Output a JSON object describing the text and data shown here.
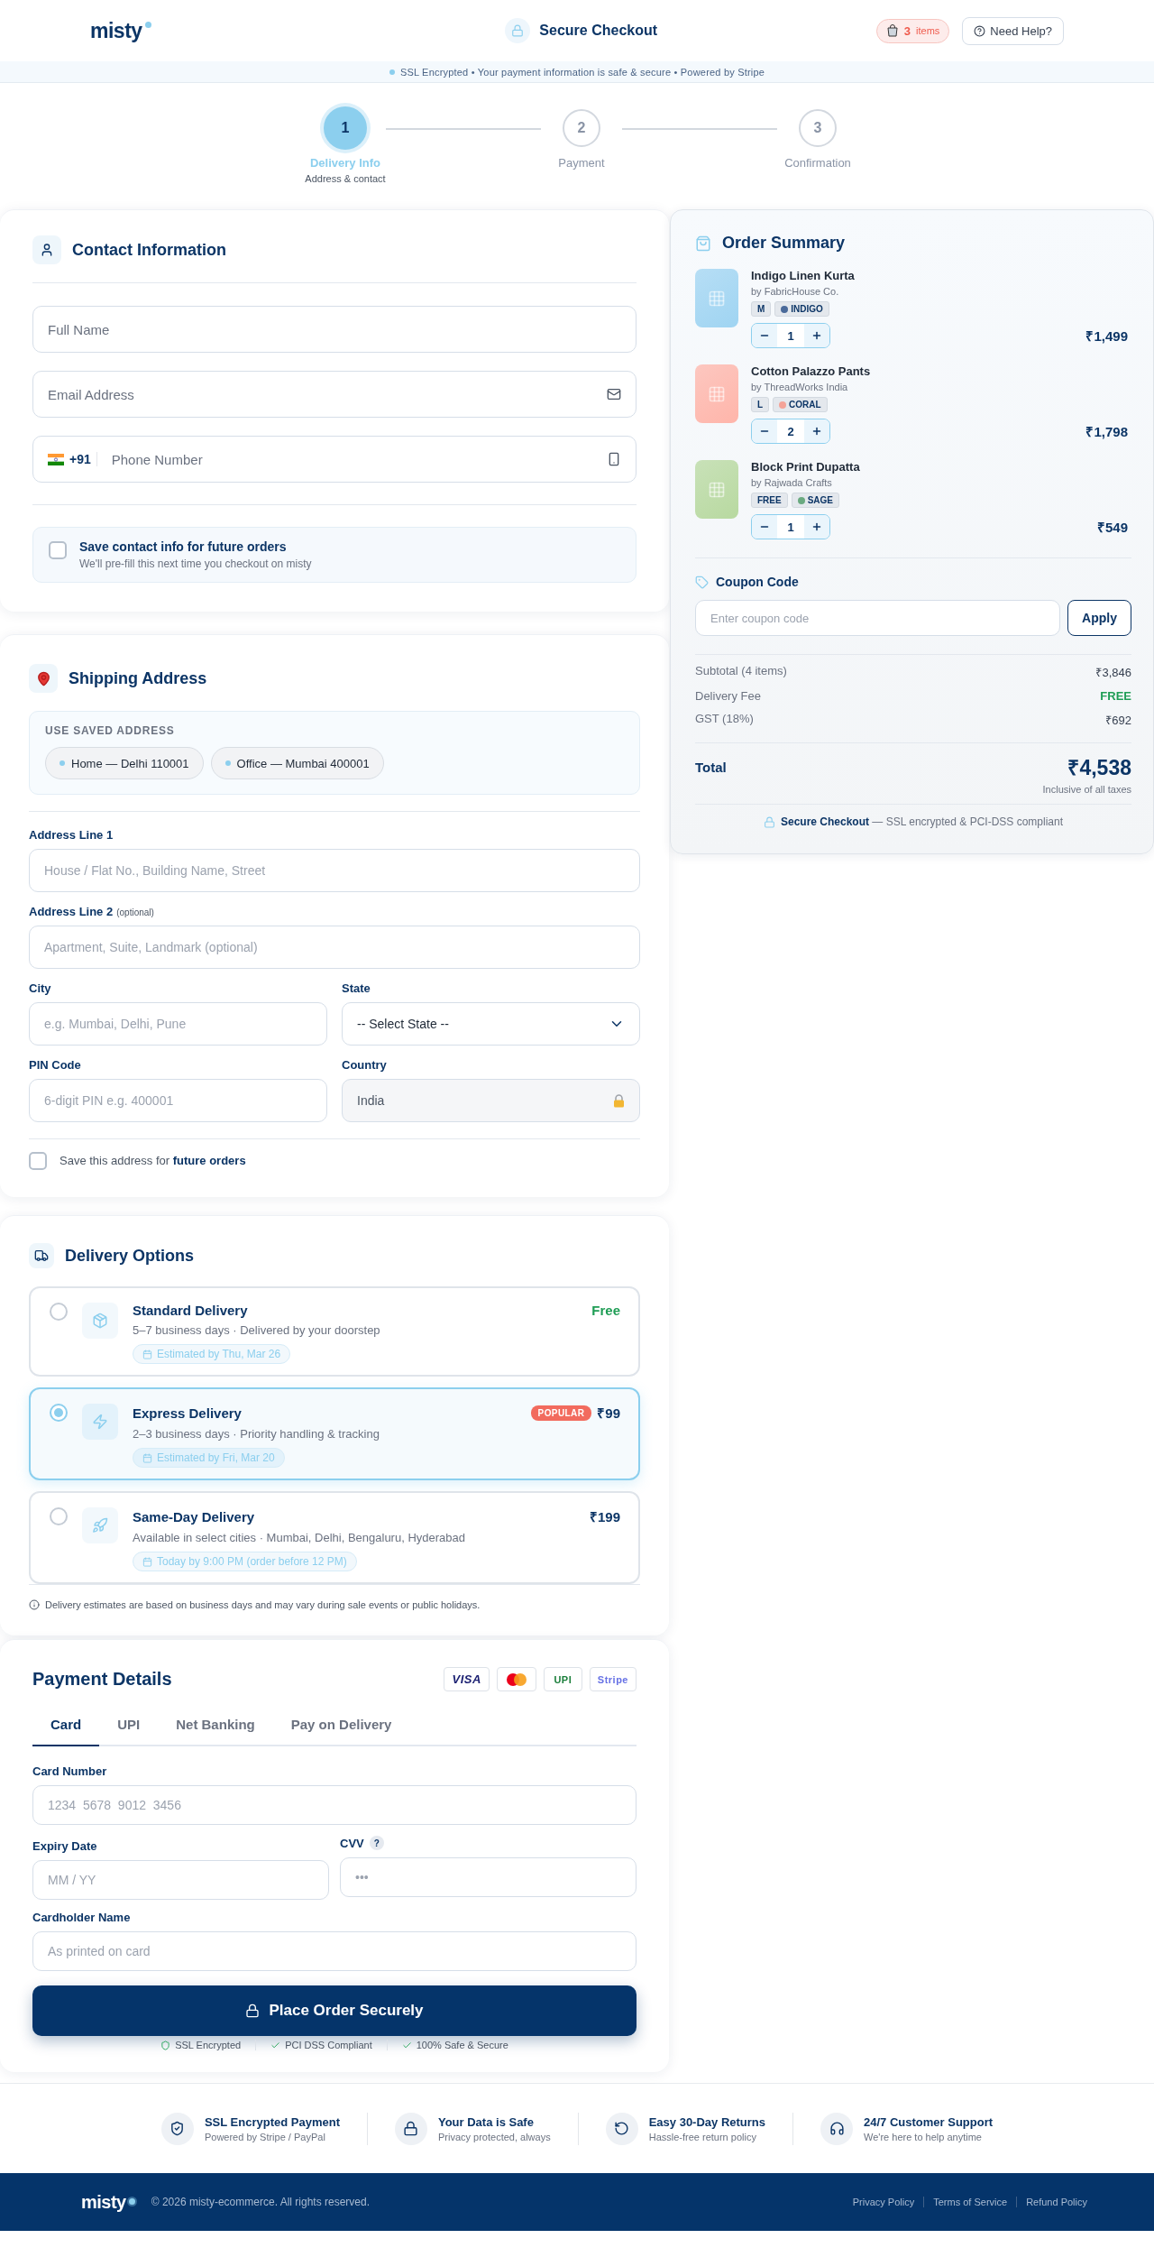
{
  "header": {
    "logo": "misty",
    "title": "Secure Checkout",
    "cart": {
      "count": "3",
      "label": "items"
    },
    "help": "Need Help?"
  },
  "banner": "SSL Encrypted • Your payment information is safe & secure • Powered by Stripe",
  "steps": [
    {
      "number": "1",
      "label": "Delivery Info",
      "sublabel": "Address & contact",
      "selected": true
    },
    {
      "number": "2",
      "label": "Payment",
      "selected": false
    },
    {
      "number": "3",
      "label": "Confirmation",
      "selected": false
    }
  ],
  "contact": {
    "title": "Contact Information",
    "fields": [
      {
        "kind": "text",
        "placeholder": "Full Name"
      },
      {
        "kind": "email",
        "placeholder": "Email Address"
      },
      {
        "kind": "phone",
        "prefix": "+91",
        "placeholder": "Phone Number"
      }
    ],
    "save": {
      "title": "Save contact info for future orders",
      "note": "We'll pre-fill this next time you checkout on misty",
      "checked": false
    }
  },
  "shipping": {
    "title": "Shipping Address",
    "saved": {
      "label": "USE SAVED ADDRESS",
      "chips": [
        {
          "text": "Home — Delhi 110001",
          "selected": false
        },
        {
          "text": "Office — Mumbai 400001",
          "selected": false
        }
      ]
    },
    "fields": [
      {
        "kind": "text",
        "label": "Address Line 1",
        "placeholder": "House / Flat No., Building Name, Street"
      },
      {
        "kind": "text",
        "label": "Address Line 2",
        "note": "(optional)",
        "placeholder": "Apartment, Suite, Landmark (optional)"
      },
      {
        "kind": "text",
        "label": "City",
        "placeholder": "e.g. Mumbai, Delhi, Pune"
      },
      {
        "kind": "select",
        "label": "State",
        "value": "-- Select State --"
      },
      {
        "kind": "text",
        "label": "PIN Code",
        "placeholder": "6-digit PIN e.g. 400001"
      },
      {
        "kind": "locked",
        "label": "Country",
        "value": "India"
      }
    ],
    "save": {
      "text": "Save this address for **future orders**",
      "checked": false
    }
  },
  "delivery": {
    "title": "Delivery Options",
    "options": [
      {
        "kind": "box",
        "title": "Standard Delivery",
        "description": "5–7 business days · Delivered by your doorstep",
        "estimate": "Estimated by Thu, Mar 26",
        "price": "Free",
        "free": true,
        "selected": false
      },
      {
        "kind": "bolt",
        "title": "Express Delivery",
        "description": "2–3 business days · Priority handling & tracking",
        "estimate": "Estimated by Fri, Mar 20",
        "badge": "POPULAR",
        "price": "₹99",
        "free": false,
        "selected": true
      },
      {
        "kind": "rocket",
        "title": "Same-Day Delivery",
        "description": "Available in select cities · Mumbai, Delhi, Bengaluru, Hyderabad",
        "estimate": "Today by 9:00 PM (order before 12 PM)",
        "price": "₹199",
        "free": false,
        "selected": false
      }
    ],
    "note": "Delivery estimates are based on business days and may vary during sale events or public holidays."
  },
  "payment": {
    "title": "Payment Details",
    "brands": [
      {
        "kind": "visa",
        "text": "VISA"
      },
      {
        "kind": "mastercard"
      },
      {
        "kind": "upi",
        "text": "UPI"
      },
      {
        "kind": "stripe",
        "text": "Stripe"
      }
    ],
    "tabs": [
      {
        "label": "Card",
        "selected": true
      },
      {
        "label": "UPI",
        "selected": false
      },
      {
        "label": "Net Banking",
        "selected": false
      },
      {
        "label": "Pay on Delivery",
        "selected": false
      }
    ],
    "card_number": {
      "label": "Card Number",
      "placeholder": "1234  5678  9012  3456"
    },
    "expiry": {
      "label": "Expiry Date",
      "placeholder": "MM / YY"
    },
    "cvv": {
      "label": "CVV",
      "help": "?",
      "placeholder": "•••"
    },
    "holder": {
      "label": "Cardholder Name",
      "placeholder": "As printed on card"
    },
    "button": "Place Order Securely",
    "assurances": [
      {
        "kind": "shield",
        "text": "SSL Encrypted"
      },
      {
        "kind": "check",
        "text": "PCI DSS Compliant"
      },
      {
        "kind": "check",
        "text": "100% Safe & Secure"
      }
    ]
  },
  "summary": {
    "title": "Order Summary",
    "items": [
      {
        "name": "Indigo Linen Kurta",
        "brand": "by FabricHouse Co.",
        "size": "M",
        "color_name": "INDIGO",
        "color": "#4a6a9a",
        "thumbnail": {
          "color": "#9fd4f2"
        },
        "qty": "1",
        "price": "₹1,499"
      },
      {
        "name": "Cotton Palazzo Pants",
        "brand": "by ThreadWorks India",
        "size": "L",
        "color_name": "CORAL",
        "color": "#f4a398",
        "thumbnail": {
          "color": "#ffb5aa"
        },
        "qty": "2",
        "price": "₹1,798"
      },
      {
        "name": "Block Print Dupatta",
        "brand": "by Rajwada Crafts",
        "size": "FREE",
        "color_name": "SAGE",
        "color": "#6aaa80",
        "thumbnail": {
          "color": "#b8d9a0"
        },
        "qty": "1",
        "price": "₹549"
      }
    ],
    "coupon": {
      "label": "Coupon Code",
      "placeholder": "Enter coupon code",
      "button": "Apply"
    },
    "rows": [
      {
        "label": "Subtotal (4 items)",
        "value": "₹3,846",
        "kind": "normal"
      },
      {
        "label": "Delivery Fee",
        "value": "FREE",
        "kind": "free"
      },
      {
        "label": "GST (18%)",
        "value": "₹692",
        "kind": "normal"
      }
    ],
    "total": {
      "label": "Total",
      "value": "₹4,538",
      "note": "Inclusive of all taxes"
    },
    "secure": "**Secure Checkout** — SSL encrypted & PCI-DSS compliant"
  },
  "trust": [
    {
      "kind": "shield",
      "title": "SSL Encrypted Payment",
      "subtitle": "Powered by Stripe / PayPal"
    },
    {
      "kind": "lock",
      "title": "Your Data is Safe",
      "subtitle": "Privacy protected, always"
    },
    {
      "kind": "returns",
      "title": "Easy 30-Day Returns",
      "subtitle": "Hassle-free return policy"
    },
    {
      "kind": "headset",
      "title": "24/7 Customer Support",
      "subtitle": "We're here to help anytime"
    }
  ],
  "footer": {
    "logo": "misty",
    "copyright": "© 2026 misty-ecommerce. All rights reserved.",
    "links": [
      "Privacy Policy",
      "Terms of Service",
      "Refund Policy"
    ]
  }
}
